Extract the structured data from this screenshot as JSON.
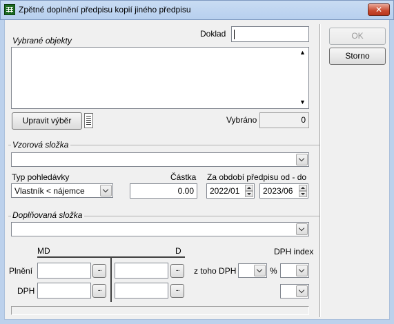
{
  "window": {
    "title": "Zpětné doplnění předpisu kopií jiného předpisu",
    "close_label": "✕"
  },
  "actions": {
    "ok_label": "OK",
    "cancel_label": "Storno"
  },
  "top": {
    "doklad_label": "Doklad",
    "doklad_value": "",
    "vybrane_objekty_label": "Vybrané objekty",
    "upravit_vyber_label": "Upravit výběr",
    "vybrano_label": "Vybráno",
    "vybrano_value": "0"
  },
  "vzorova": {
    "group_label": "Vzorová složka",
    "slozka_value": "",
    "typ_pohledavky_label": "Typ pohledávky",
    "typ_pohledavky_value": "Vlastník < nájemce",
    "castka_label": "Částka",
    "castka_value": "0.00",
    "obdobi_label": "Za období předpisu od - do",
    "obdobi_od": "2022/01",
    "obdobi_do": "2023/06"
  },
  "doplnovana": {
    "group_label": "Doplňovaná složka",
    "slozka_value": "",
    "md_label": "MD",
    "d_label": "D",
    "dph_index_label": "DPH index",
    "plneni_label": "Plnění",
    "dph_label": "DPH",
    "z_toho_dph_label": "z toho DPH",
    "percent_label": "%",
    "ellipsis": "..."
  }
}
